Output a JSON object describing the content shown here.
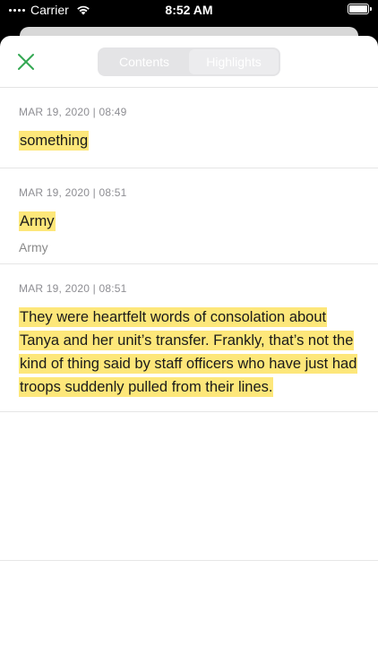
{
  "status_bar": {
    "carrier": "Carrier",
    "time": "8:52 AM"
  },
  "header": {
    "close_icon": "close-x-icon",
    "accent_color": "#34a853",
    "tabs": [
      {
        "label": "Contents",
        "selected": false
      },
      {
        "label": "Highlights",
        "selected": true
      }
    ]
  },
  "highlights": [
    {
      "date": "MAR 19, 2020 | 08:49",
      "text": "something",
      "note": ""
    },
    {
      "date": "MAR 19, 2020 | 08:51",
      "text": "Army",
      "note": "Army"
    },
    {
      "date": "MAR 19, 2020 | 08:51",
      "text": "They were heartfelt words of consolation about Tanya and her unit’s transfer. Frankly, that’s not the kind of thing said by staff officers who have just had troops suddenly pulled from their lines.",
      "note": ""
    }
  ],
  "highlight_color": "#fde77a"
}
